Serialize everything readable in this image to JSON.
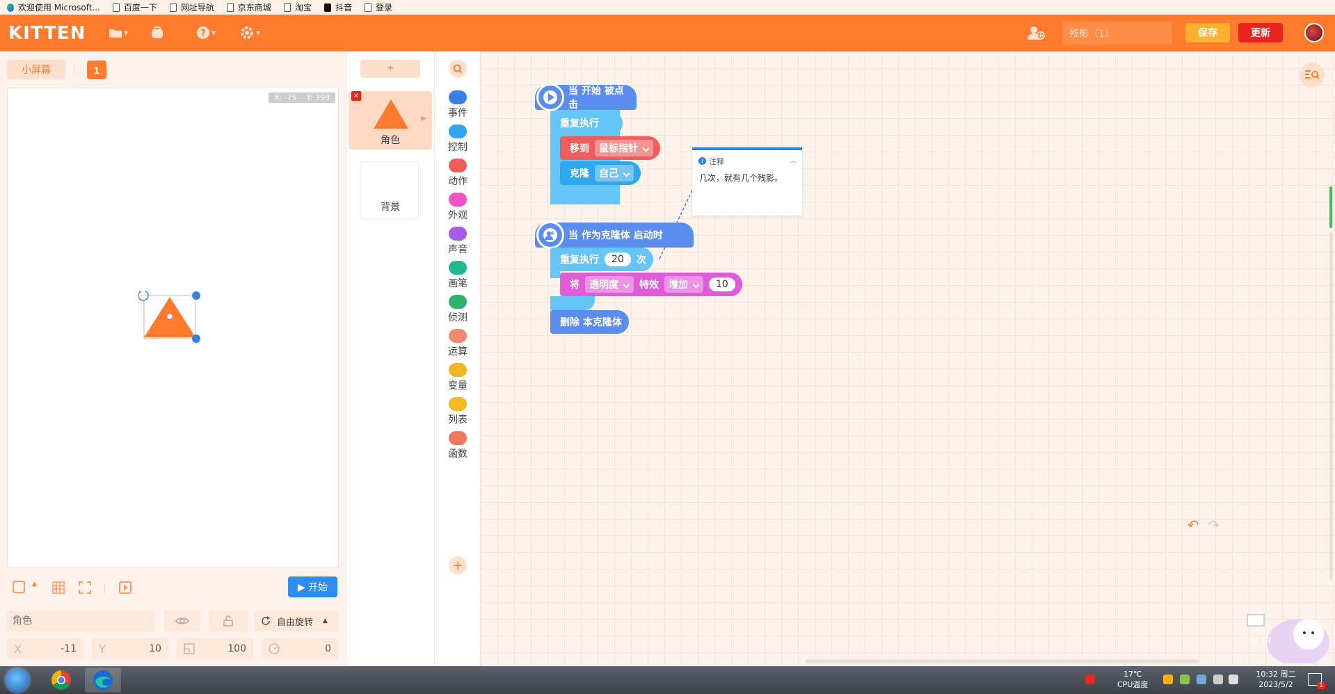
{
  "bookmarks": [
    {
      "label": "欢迎使用 Microsoft...",
      "icon": "edge-icon"
    },
    {
      "label": "百度一下",
      "icon": "page-icon"
    },
    {
      "label": "网址导航",
      "icon": "page-icon"
    },
    {
      "label": "京东商城",
      "icon": "page-icon"
    },
    {
      "label": "淘宝",
      "icon": "page-icon"
    },
    {
      "label": "抖音",
      "icon": "tiktok-icon"
    },
    {
      "label": "登录",
      "icon": "page-icon"
    }
  ],
  "header": {
    "logo": "KITTEN",
    "project_name": "残影（1）",
    "save_label": "保存",
    "update_label": "更新",
    "brand_color": "#fe7b2d"
  },
  "stage": {
    "small_screen_label": "小屏幕",
    "screen_number": "1",
    "coord_x": "X: -75",
    "coord_y": "Y: 398",
    "start_label": "开始"
  },
  "sprite_props": {
    "name_placeholder": "角色",
    "rotation_mode": "自由旋转",
    "x_label": "X",
    "x_value": "-11",
    "y_label": "Y",
    "y_value": "10",
    "size_value": "100",
    "direction_value": "0"
  },
  "sprites": {
    "add_label": "+",
    "selected_sprite_label": "角色",
    "background_label": "背景"
  },
  "categories": [
    {
      "label": "事件",
      "color": "#3a7fe8",
      "icon": "event-icon"
    },
    {
      "label": "控制",
      "color": "#2fa7f0",
      "icon": "control-icon"
    },
    {
      "label": "动作",
      "color": "#ef5d5d",
      "icon": "motion-icon"
    },
    {
      "label": "外观",
      "color": "#ea54c7",
      "icon": "looks-icon"
    },
    {
      "label": "声音",
      "color": "#a55de8",
      "icon": "sound-icon"
    },
    {
      "label": "画笔",
      "color": "#21b98e",
      "icon": "pen-icon"
    },
    {
      "label": "侦测",
      "color": "#2bb36b",
      "icon": "sensing-icon"
    },
    {
      "label": "运算",
      "color": "#f3886e",
      "icon": "operators-icon"
    },
    {
      "label": "变量",
      "color": "#f4b423",
      "icon": "variables-icon"
    },
    {
      "label": "列表",
      "color": "#f5b922",
      "icon": "list-icon"
    },
    {
      "label": "函数",
      "color": "#f1775a",
      "icon": "function-icon"
    }
  ],
  "script1": {
    "hat": "当 开始 被点击",
    "repeat_forever": "重复执行",
    "move_to": "移到",
    "move_target": "鼠标指针",
    "clone": "克隆",
    "clone_target": "自己"
  },
  "script2": {
    "hat": "当 作为克隆体 启动时",
    "repeat": "重复执行",
    "repeat_count": "20",
    "times": "次",
    "set_prefix": "将",
    "effect_name": "透明度",
    "effect_label": "特效",
    "effect_op": "增加",
    "effect_value": "10",
    "delete_clone": "删除 本克隆体"
  },
  "comment": {
    "title": "注释",
    "body": "几次，就有几个残影。"
  },
  "mascot_text": "半 中",
  "taskbar": {
    "temperature": "17℃",
    "cpu_label": "CPU温度",
    "time": "10:32 周二",
    "date": "2023/5/2",
    "notification_count": "1"
  }
}
